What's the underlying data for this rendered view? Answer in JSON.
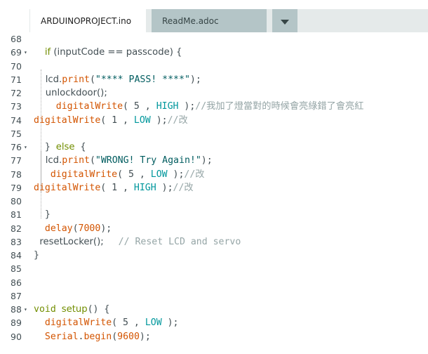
{
  "tabs": [
    {
      "label": "ARDUINOPROJECT.ino",
      "active": true
    },
    {
      "label": "ReadMe.adoc",
      "active": false
    }
  ],
  "tab_menu_icon": "chevron-down-icon",
  "colors": {
    "keyword": "#728e00",
    "function": "#d35400",
    "string": "#005c5f",
    "constant": "#00979c",
    "comment": "#95a5a6",
    "text": "#434f54",
    "tab_inactive": "#b4c5c7",
    "tab_strip": "#e5eaea"
  },
  "fold_icon": "fold-arrow-icon",
  "lines": [
    {
      "num": "68",
      "fold": false,
      "segs": []
    },
    {
      "num": "69",
      "fold": true,
      "segs": [
        {
          "t": "  ",
          "c": "plain"
        },
        {
          "t": "if",
          "c": "kw",
          "f": "sans"
        },
        {
          "t": " (inputCode == passcode) {",
          "c": "plain",
          "f": "sans"
        }
      ]
    },
    {
      "num": "70",
      "fold": false,
      "segs": []
    },
    {
      "num": "71",
      "fold": false,
      "segs": [
        {
          "t": "    lcd.",
          "c": "plain",
          "f": "sans"
        },
        {
          "t": "print",
          "c": "fn"
        },
        {
          "t": "(",
          "c": "plain"
        },
        {
          "t": "\"**** PASS! ****\"",
          "c": "str"
        },
        {
          "t": ");",
          "c": "plain"
        }
      ]
    },
    {
      "num": "72",
      "fold": false,
      "segs": [
        {
          "t": "    unlockdoor();",
          "c": "plain",
          "f": "sans"
        }
      ]
    },
    {
      "num": "73",
      "fold": false,
      "segs": [
        {
          "t": "    ",
          "c": "plain"
        },
        {
          "t": "digitalWrite",
          "c": "fn"
        },
        {
          "t": "( 5 , ",
          "c": "plain"
        },
        {
          "t": "HIGH",
          "c": "cst"
        },
        {
          "t": " );",
          "c": "plain"
        },
        {
          "t": "//我加了燈當對的時候會亮綠錯了會亮紅",
          "c": "cmt"
        }
      ]
    },
    {
      "num": "74",
      "fold": false,
      "segs": [
        {
          "t": "digitalWrite",
          "c": "fn"
        },
        {
          "t": "( 1 , ",
          "c": "plain"
        },
        {
          "t": "LOW",
          "c": "cst"
        },
        {
          "t": " );",
          "c": "plain"
        },
        {
          "t": "//改",
          "c": "cmt"
        }
      ]
    },
    {
      "num": "75",
      "fold": false,
      "segs": []
    },
    {
      "num": "76",
      "fold": true,
      "segs": [
        {
          "t": "  } ",
          "c": "plain"
        },
        {
          "t": "else",
          "c": "kw",
          "f": "sans"
        },
        {
          "t": " {",
          "c": "plain"
        }
      ]
    },
    {
      "num": "77",
      "fold": false,
      "segs": [
        {
          "t": "    lcd.",
          "c": "plain",
          "f": "sans"
        },
        {
          "t": "print",
          "c": "fn"
        },
        {
          "t": "(",
          "c": "plain"
        },
        {
          "t": "\"WRONG! Try Again!\"",
          "c": "str"
        },
        {
          "t": ");",
          "c": "plain"
        }
      ]
    },
    {
      "num": "78",
      "fold": false,
      "segs": [
        {
          "t": "   ",
          "c": "plain"
        },
        {
          "t": "digitalWrite",
          "c": "fn"
        },
        {
          "t": "( 5 , ",
          "c": "plain"
        },
        {
          "t": "LOW",
          "c": "cst"
        },
        {
          "t": " );",
          "c": "plain"
        },
        {
          "t": "//改",
          "c": "cmt"
        }
      ]
    },
    {
      "num": "79",
      "fold": false,
      "segs": [
        {
          "t": "digitalWrite",
          "c": "fn"
        },
        {
          "t": "( 1 , ",
          "c": "plain"
        },
        {
          "t": "HIGH",
          "c": "cst"
        },
        {
          "t": " );",
          "c": "plain"
        },
        {
          "t": "//改",
          "c": "cmt"
        }
      ]
    },
    {
      "num": "80",
      "fold": false,
      "segs": []
    },
    {
      "num": "81",
      "fold": false,
      "segs": [
        {
          "t": "  }",
          "c": "plain"
        }
      ]
    },
    {
      "num": "82",
      "fold": false,
      "segs": [
        {
          "t": "  ",
          "c": "plain"
        },
        {
          "t": "delay",
          "c": "fn"
        },
        {
          "t": "(",
          "c": "plain"
        },
        {
          "t": "7000",
          "c": "fn"
        },
        {
          "t": ");",
          "c": "plain"
        }
      ]
    },
    {
      "num": "83",
      "fold": false,
      "segs": [
        {
          "t": "  resetLocker();     ",
          "c": "plain",
          "f": "sans"
        },
        {
          "t": "// Reset LCD and servo",
          "c": "cmt"
        }
      ]
    },
    {
      "num": "84",
      "fold": false,
      "segs": [
        {
          "t": "}",
          "c": "plain"
        }
      ]
    },
    {
      "num": "85",
      "fold": false,
      "segs": []
    },
    {
      "num": "86",
      "fold": false,
      "segs": []
    },
    {
      "num": "87",
      "fold": false,
      "segs": []
    },
    {
      "num": "88",
      "fold": true,
      "segs": [
        {
          "t": "void",
          "c": "kw"
        },
        {
          "t": " ",
          "c": "plain"
        },
        {
          "t": "setup",
          "c": "kw",
          "f": "sans"
        },
        {
          "t": "() {",
          "c": "plain"
        }
      ]
    },
    {
      "num": "89",
      "fold": false,
      "segs": [
        {
          "t": "  ",
          "c": "plain"
        },
        {
          "t": "digitalWrite",
          "c": "fn"
        },
        {
          "t": "( 5 , ",
          "c": "plain"
        },
        {
          "t": "LOW",
          "c": "cst"
        },
        {
          "t": " );",
          "c": "plain"
        }
      ]
    },
    {
      "num": "90",
      "fold": false,
      "segs": [
        {
          "t": "  ",
          "c": "plain"
        },
        {
          "t": "Serial",
          "c": "fn"
        },
        {
          "t": ".",
          "c": "plain"
        },
        {
          "t": "begin",
          "c": "fn"
        },
        {
          "t": "(",
          "c": "plain"
        },
        {
          "t": "9600",
          "c": "fn"
        },
        {
          "t": ");",
          "c": "plain"
        }
      ]
    }
  ]
}
